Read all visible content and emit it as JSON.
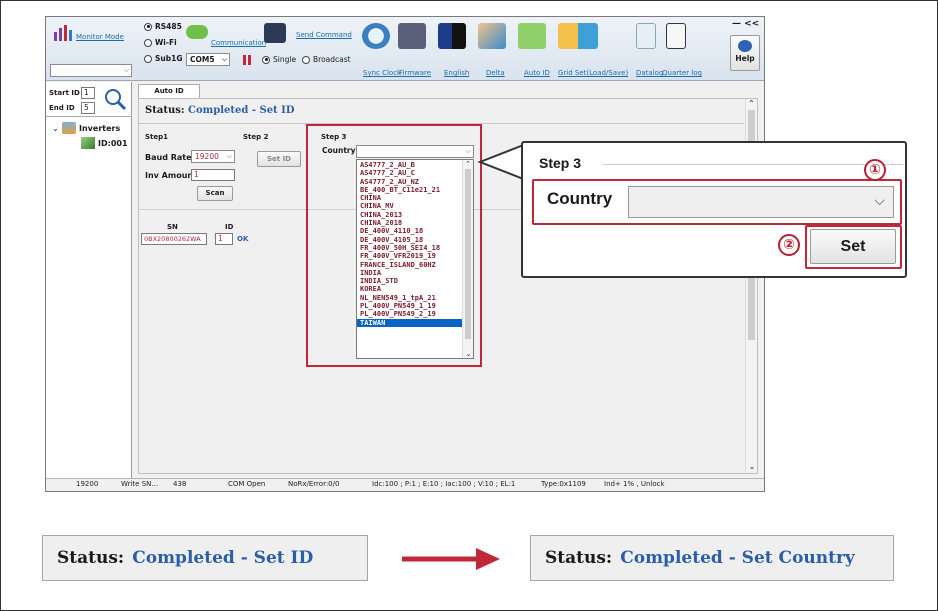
{
  "toolbar": {
    "monitor_mode": "Monitor Mode",
    "comm_options": [
      "RS485",
      "Wi-Fi",
      "Sub1G"
    ],
    "comm_selected": "RS485",
    "communication": "Communication",
    "com_port": "COM5",
    "send_command": "Send Command",
    "send_mode_options": [
      "Single",
      "Broadcast"
    ],
    "send_mode_selected": "Single",
    "tools": [
      "Sync Clock",
      "Firmware",
      "English",
      "Delta",
      "Auto ID",
      "Grid Set(Load/Save)",
      "Datalog",
      "Quarter log"
    ],
    "help": "Help",
    "window_ctrl": "— <<"
  },
  "left": {
    "start_id_label": "Start ID",
    "start_id": "1",
    "end_id_label": "End ID",
    "end_id": "5",
    "tree_root": "Inverters",
    "tree_child": "ID:001"
  },
  "main": {
    "tab": "Auto ID",
    "status_label": "Status:",
    "status_value": "Completed - Set ID",
    "step1": "Step1",
    "step2": "Step 2",
    "step3": "Step 3",
    "baud_label": "Baud Rate",
    "baud_value": "19200",
    "set_id_btn": "Set ID",
    "inv_amount_label": "Inv Amount",
    "inv_amount_value": "1",
    "scan_btn": "Scan",
    "country_label": "Country",
    "sn_header": "SN",
    "id_header": "ID",
    "sn_value": "0BX20800262WA",
    "id_value": "1",
    "ok": "OK",
    "countries": [
      "AS4777_2_AU_B",
      "AS4777_2_AU_C",
      "AS4777_2_AU_NZ",
      "BE_400_BT_C11e21_21",
      "CHINA",
      "CHINA_MV",
      "CHINA_2013",
      "CHINA_2018",
      "DE_400V_4110_18",
      "DE_400V_4105_18",
      "FR_400V_50H_SEI4_18",
      "FR_400V_VFR2019_19",
      "FRANCE_ISLAND_60HZ",
      "INDIA",
      "INDIA_STD",
      "KOREA",
      "NL_NEN549_1_tpA_21",
      "PL_400V_PN549_1_19",
      "PL_400V_PN549_2_19",
      "TAIWAN"
    ],
    "selected_country": "TAIWAN"
  },
  "statusbar": [
    "19200",
    "Write SN...",
    "438",
    "COM Open",
    "NoRx/Error:0/0",
    "Idc:100 ; P:1 ; E:10 ; Iac:100 ; V:10 ; EL:1",
    "Type:0x1109",
    "Ind+ 1% , Unlock"
  ],
  "callout": {
    "title": "Step 3",
    "country_label": "Country",
    "set_btn": "Set",
    "marker1": "①",
    "marker2": "②"
  },
  "bottom": {
    "status_label": "Status:",
    "before": "Completed - Set ID",
    "after": "Completed - Set Country"
  },
  "colors": {
    "accent_red": "#c0283a",
    "status_blue": "#2b5ea8",
    "list_text": "#7a1a2a",
    "selection": "#0a64c8"
  }
}
